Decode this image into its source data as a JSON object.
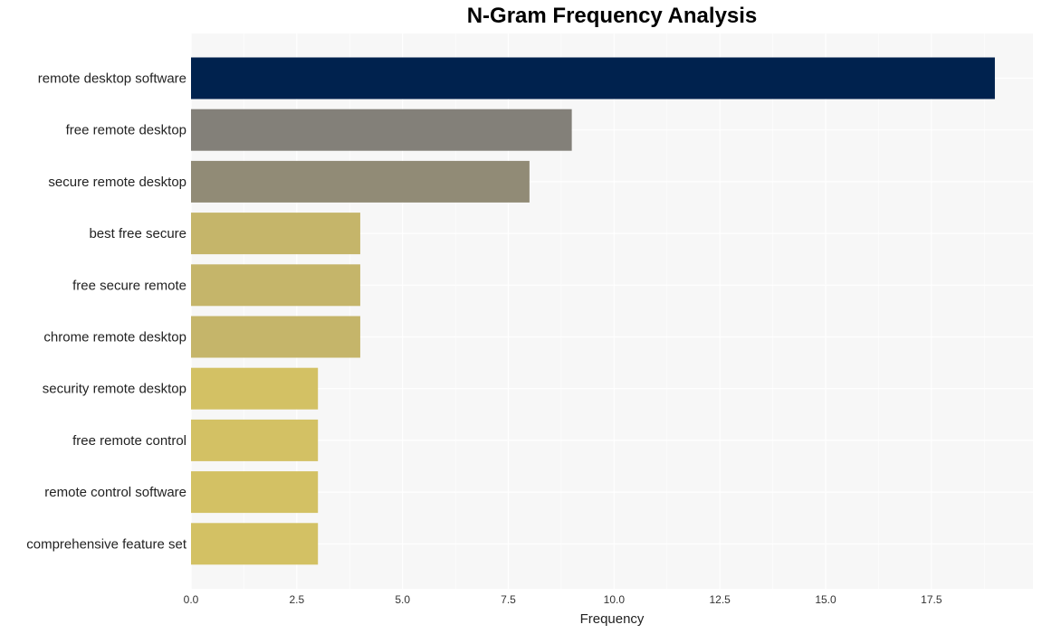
{
  "chart_data": {
    "type": "bar",
    "orientation": "horizontal",
    "title": "N-Gram Frequency Analysis",
    "xlabel": "Frequency",
    "ylabel": "",
    "xlim": [
      0,
      19.9
    ],
    "xticks": [
      0,
      2.5,
      5,
      7.5,
      10,
      12.5,
      15,
      17.5
    ],
    "xtick_labels": [
      "0.0",
      "2.5",
      "5.0",
      "7.5",
      "10.0",
      "12.5",
      "15.0",
      "17.5"
    ],
    "grid": true,
    "legend": "none",
    "categories": [
      "remote desktop software",
      "free remote desktop",
      "secure remote desktop",
      "best free secure",
      "free secure remote",
      "chrome remote desktop",
      "security remote desktop",
      "free remote control",
      "remote control software",
      "comprehensive feature set"
    ],
    "values": [
      19,
      9,
      8,
      4,
      4,
      4,
      3,
      3,
      3,
      3
    ],
    "colors": [
      "#00224e",
      "#838079",
      "#918b76",
      "#c5b56a",
      "#c5b56a",
      "#c5b56a",
      "#d3c164",
      "#d3c164",
      "#d3c164",
      "#d3c164"
    ],
    "panel_background": "#f7f7f7",
    "grid_color": "#ffffff"
  }
}
